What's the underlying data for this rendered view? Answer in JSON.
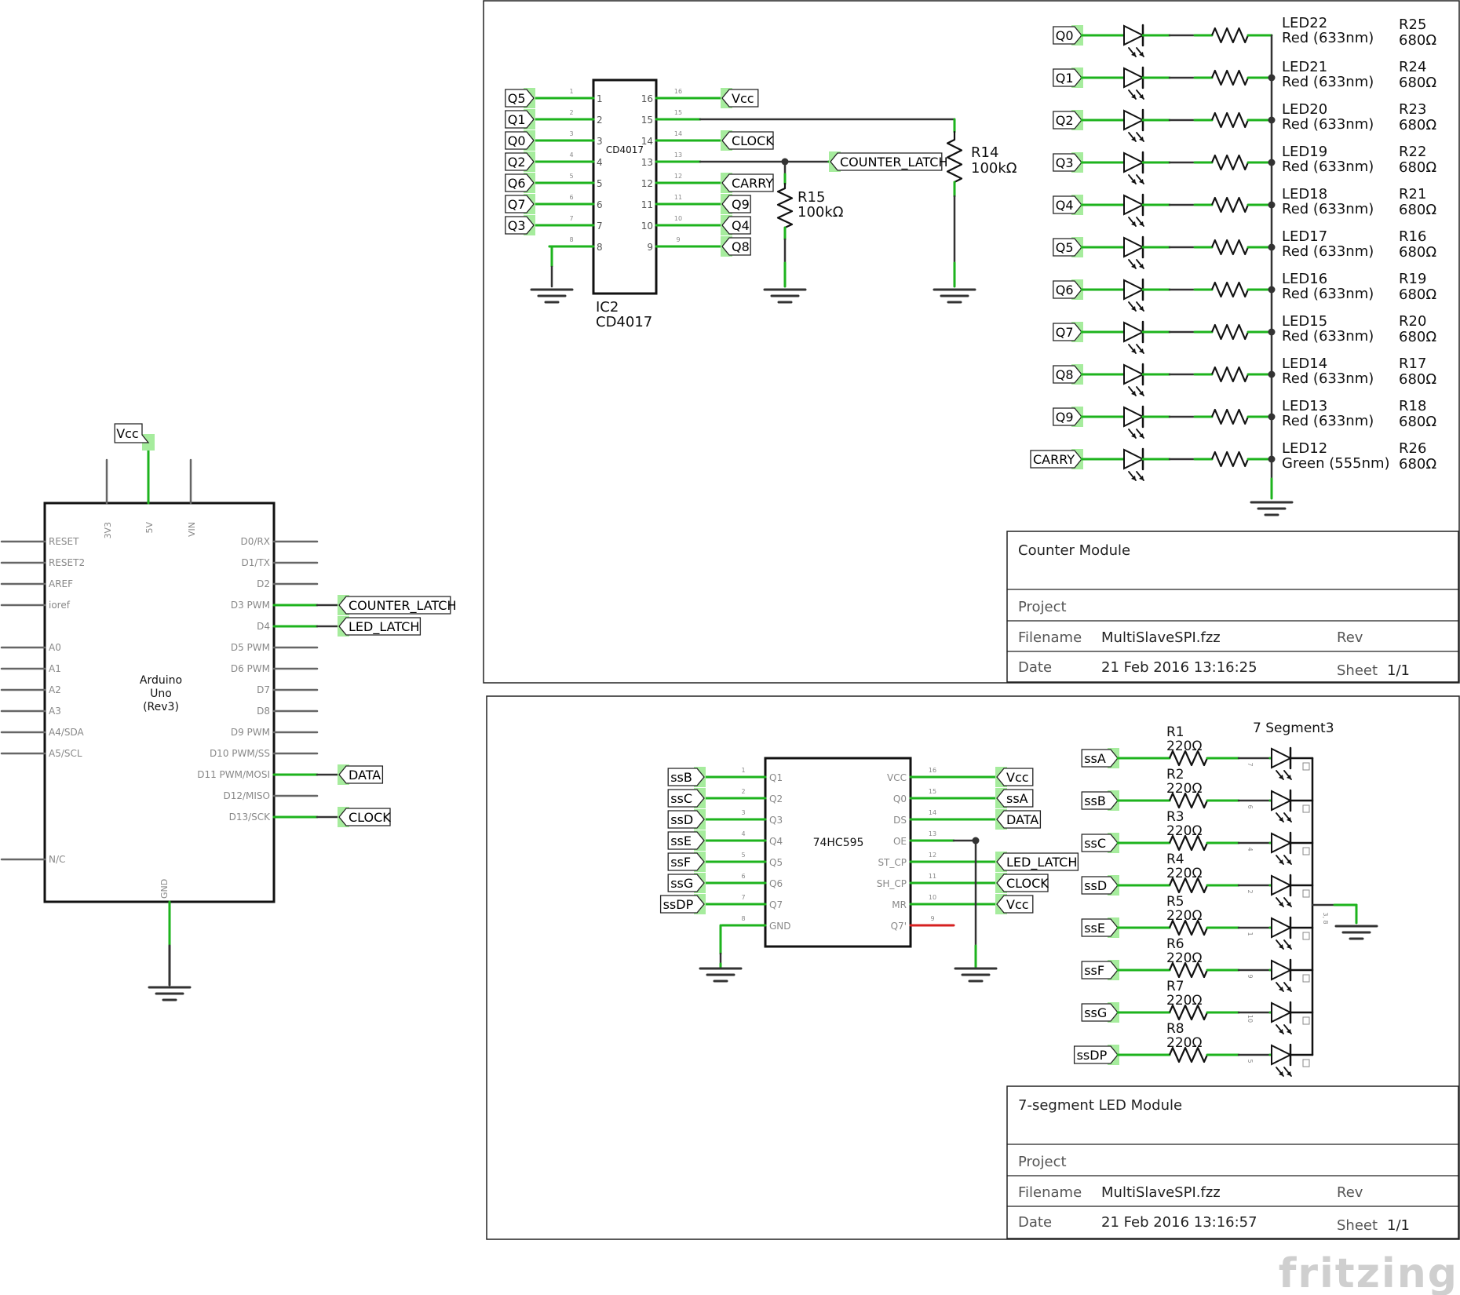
{
  "arduino": {
    "name_lines": [
      "Arduino",
      "Uno",
      "(Rev3)"
    ],
    "top_pins": [
      "3V3",
      "5V",
      "VIN"
    ],
    "gnd_pin": "GND",
    "left_pins": [
      "RESET",
      "RESET2",
      "AREF",
      "ioref",
      "A0",
      "A1",
      "A2",
      "A3",
      "A4/SDA",
      "A5/SCL",
      "N/C"
    ],
    "right_pins": [
      "D0/RX",
      "D1/TX",
      "D2",
      "D3 PWM",
      "D4",
      "D5 PWM",
      "D6 PWM",
      "D7",
      "D8",
      "D9 PWM",
      "D10 PWM/SS",
      "D11 PWM/MOSI",
      "D12/MISO",
      "D13/SCK"
    ],
    "vcc_label": "Vcc",
    "net_labels": {
      "d3": "COUNTER_LATCH",
      "d4": "LED_LATCH",
      "d11": "DATA",
      "d13": "CLOCK"
    }
  },
  "counter_module": {
    "ic": {
      "chip_text": "CD4017",
      "designator": "IC2",
      "part": "CD4017",
      "left_pin_numbers": [
        "1",
        "2",
        "3",
        "4",
        "5",
        "6",
        "7",
        "8"
      ],
      "right_pin_numbers": [
        "16",
        "15",
        "14",
        "13",
        "12",
        "11",
        "10",
        "9"
      ],
      "left_nets": [
        "Q5",
        "Q1",
        "Q0",
        "Q2",
        "Q6",
        "Q7",
        "Q3"
      ],
      "right_nets": [
        "Vcc",
        "",
        "CLOCK",
        "COUNTER_LATCH",
        "CARRY",
        "Q9",
        "Q4",
        "Q8"
      ]
    },
    "r14": {
      "name": "R14",
      "value": "100kΩ"
    },
    "r15": {
      "name": "R15",
      "value": "100kΩ"
    },
    "leds": [
      {
        "net": "Q0",
        "led": "LED22",
        "color": "Red (633nm)",
        "res": "R25",
        "value": "680Ω"
      },
      {
        "net": "Q1",
        "led": "LED21",
        "color": "Red (633nm)",
        "res": "R24",
        "value": "680Ω"
      },
      {
        "net": "Q2",
        "led": "LED20",
        "color": "Red (633nm)",
        "res": "R23",
        "value": "680Ω"
      },
      {
        "net": "Q3",
        "led": "LED19",
        "color": "Red (633nm)",
        "res": "R22",
        "value": "680Ω"
      },
      {
        "net": "Q4",
        "led": "LED18",
        "color": "Red (633nm)",
        "res": "R21",
        "value": "680Ω"
      },
      {
        "net": "Q5",
        "led": "LED17",
        "color": "Red (633nm)",
        "res": "R16",
        "value": "680Ω"
      },
      {
        "net": "Q6",
        "led": "LED16",
        "color": "Red (633nm)",
        "res": "R19",
        "value": "680Ω"
      },
      {
        "net": "Q7",
        "led": "LED15",
        "color": "Red (633nm)",
        "res": "R20",
        "value": "680Ω"
      },
      {
        "net": "Q8",
        "led": "LED14",
        "color": "Red (633nm)",
        "res": "R17",
        "value": "680Ω"
      },
      {
        "net": "Q9",
        "led": "LED13",
        "color": "Red (633nm)",
        "res": "R18",
        "value": "680Ω"
      },
      {
        "net": "CARRY",
        "led": "LED12",
        "color": "Green (555nm)",
        "res": "R26",
        "value": "680Ω"
      }
    ],
    "title_block": {
      "title": "Counter Module",
      "project": "Project",
      "filename_label": "Filename",
      "filename": "MultiSlaveSPI.fzz",
      "rev": "Rev",
      "date_label": "Date",
      "date": "21 Feb 2016 13:16:25",
      "sheet_label": "Sheet",
      "sheet": "1/1"
    }
  },
  "seg_module": {
    "ic": {
      "chip_text": "74HC595",
      "left_pins": [
        "Q1",
        "Q2",
        "Q3",
        "Q4",
        "Q5",
        "Q6",
        "Q7",
        "GND"
      ],
      "right_pins": [
        "VCC",
        "Q0",
        "DS",
        "OE",
        "ST_CP",
        "SH_CP",
        "MR",
        "Q7'"
      ],
      "left_pin_numbers": [
        "1",
        "2",
        "3",
        "4",
        "5",
        "6",
        "7",
        "8"
      ],
      "right_pin_numbers": [
        "16",
        "15",
        "14",
        "13",
        "12",
        "11",
        "10",
        "9"
      ],
      "left_nets": [
        "ssB",
        "ssC",
        "ssD",
        "ssE",
        "ssF",
        "ssG",
        "ssDP"
      ],
      "right_nets": [
        "Vcc",
        "ssA",
        "DATA",
        "",
        "LED_LATCH",
        "CLOCK",
        "Vcc"
      ]
    },
    "display_name": "7 Segment3",
    "display_right_pin": "3, 8",
    "rows": [
      {
        "net": "ssA",
        "res": "R1",
        "value": "220Ω",
        "pin": "7"
      },
      {
        "net": "ssB",
        "res": "R2",
        "value": "220Ω",
        "pin": "6"
      },
      {
        "net": "ssC",
        "res": "R3",
        "value": "220Ω",
        "pin": "4"
      },
      {
        "net": "ssD",
        "res": "R4",
        "value": "220Ω",
        "pin": "2"
      },
      {
        "net": "ssE",
        "res": "R5",
        "value": "220Ω",
        "pin": "1"
      },
      {
        "net": "ssF",
        "res": "R6",
        "value": "220Ω",
        "pin": "9"
      },
      {
        "net": "ssG",
        "res": "R7",
        "value": "220Ω",
        "pin": "10"
      },
      {
        "net": "ssDP",
        "res": "R8",
        "value": "220Ω",
        "pin": "5"
      }
    ],
    "title_block": {
      "title": "7-segment LED Module",
      "project": "Project",
      "filename_label": "Filename",
      "filename": "MultiSlaveSPI.fzz",
      "rev": "Rev",
      "date_label": "Date",
      "date": "21 Feb 2016 13:16:57",
      "sheet_label": "Sheet",
      "sheet": "1/1"
    }
  },
  "watermark": "fritzing",
  "colors": {
    "wire": "#333333",
    "pin": "#1db31d",
    "highlight": "#a6ec9d",
    "unconnected": "#d62020"
  }
}
